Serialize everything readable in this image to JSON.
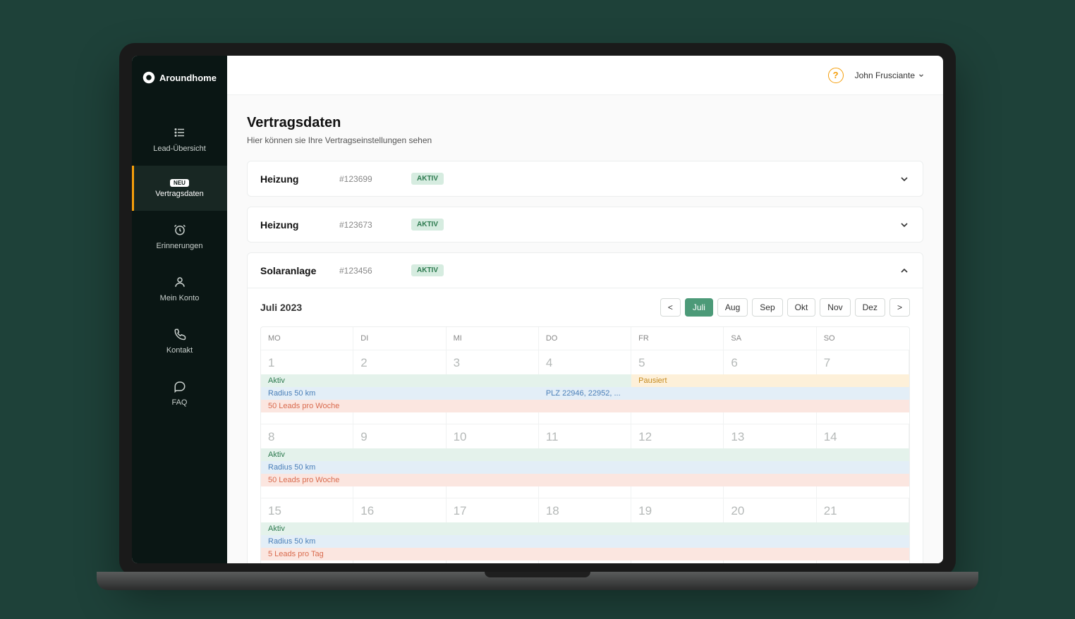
{
  "brand": "Aroundhome",
  "sidebar": {
    "items": [
      {
        "label": "Lead-Übersicht"
      },
      {
        "label": "Vertragsdaten",
        "badge": "NEU"
      },
      {
        "label": "Erinnerungen"
      },
      {
        "label": "Mein Konto"
      },
      {
        "label": "Kontakt"
      },
      {
        "label": "FAQ"
      }
    ]
  },
  "topbar": {
    "help": "?",
    "user": "John Frusciante"
  },
  "page": {
    "title": "Vertragsdaten",
    "subtitle": "Hier können sie Ihre Vertragseinstellungen sehen"
  },
  "contracts": [
    {
      "name": "Heizung",
      "id": "#123699",
      "status": "AKTIV"
    },
    {
      "name": "Heizung",
      "id": "#123673",
      "status": "AKTIV"
    },
    {
      "name": "Solaranlage",
      "id": "#123456",
      "status": "AKTIV"
    }
  ],
  "calendar": {
    "month_label": "Juli 2023",
    "prev": "<",
    "next": ">",
    "months": [
      "Juli",
      "Aug",
      "Sep",
      "Okt",
      "Nov",
      "Dez"
    ],
    "active_month": "Juli",
    "dow": [
      "MO",
      "DI",
      "MI",
      "DO",
      "FR",
      "SA",
      "SO"
    ],
    "weeks": [
      {
        "days": [
          "1",
          "2",
          "3",
          "4",
          "5",
          "6",
          "7"
        ],
        "rows": [
          {
            "type": "split",
            "cells": [
              {
                "cls": "green",
                "text": "Aktiv"
              },
              {
                "cls": "green",
                "text": ""
              },
              {
                "cls": "green",
                "text": ""
              },
              {
                "cls": "green",
                "text": ""
              },
              {
                "cls": "yellow",
                "text": "Pausiert"
              },
              {
                "cls": "yellow",
                "text": ""
              },
              {
                "cls": "yellow",
                "text": ""
              }
            ]
          },
          {
            "type": "split",
            "cells": [
              {
                "cls": "blue",
                "text": "Radius 50 km"
              },
              {
                "cls": "blue",
                "text": ""
              },
              {
                "cls": "blue",
                "text": ""
              },
              {
                "cls": "blue",
                "text": "PLZ 22946, 22952, ..."
              },
              {
                "cls": "blue",
                "text": ""
              },
              {
                "cls": "blue",
                "text": ""
              },
              {
                "cls": "blue",
                "text": ""
              }
            ]
          },
          {
            "type": "full",
            "cls": "red",
            "text": "50 Leads pro Woche"
          }
        ]
      },
      {
        "days": [
          "8",
          "9",
          "10",
          "11",
          "12",
          "13",
          "14"
        ],
        "rows": [
          {
            "type": "full",
            "cls": "green",
            "text": "Aktiv"
          },
          {
            "type": "full",
            "cls": "blue",
            "text": "Radius 50 km"
          },
          {
            "type": "full",
            "cls": "red",
            "text": "50 Leads pro Woche"
          }
        ]
      },
      {
        "days": [
          "15",
          "16",
          "17",
          "18",
          "19",
          "20",
          "21"
        ],
        "rows": [
          {
            "type": "full",
            "cls": "green",
            "text": "Aktiv"
          },
          {
            "type": "full",
            "cls": "blue",
            "text": "Radius 50 km"
          },
          {
            "type": "full",
            "cls": "red",
            "text": "5 Leads pro Tag"
          }
        ]
      }
    ]
  }
}
